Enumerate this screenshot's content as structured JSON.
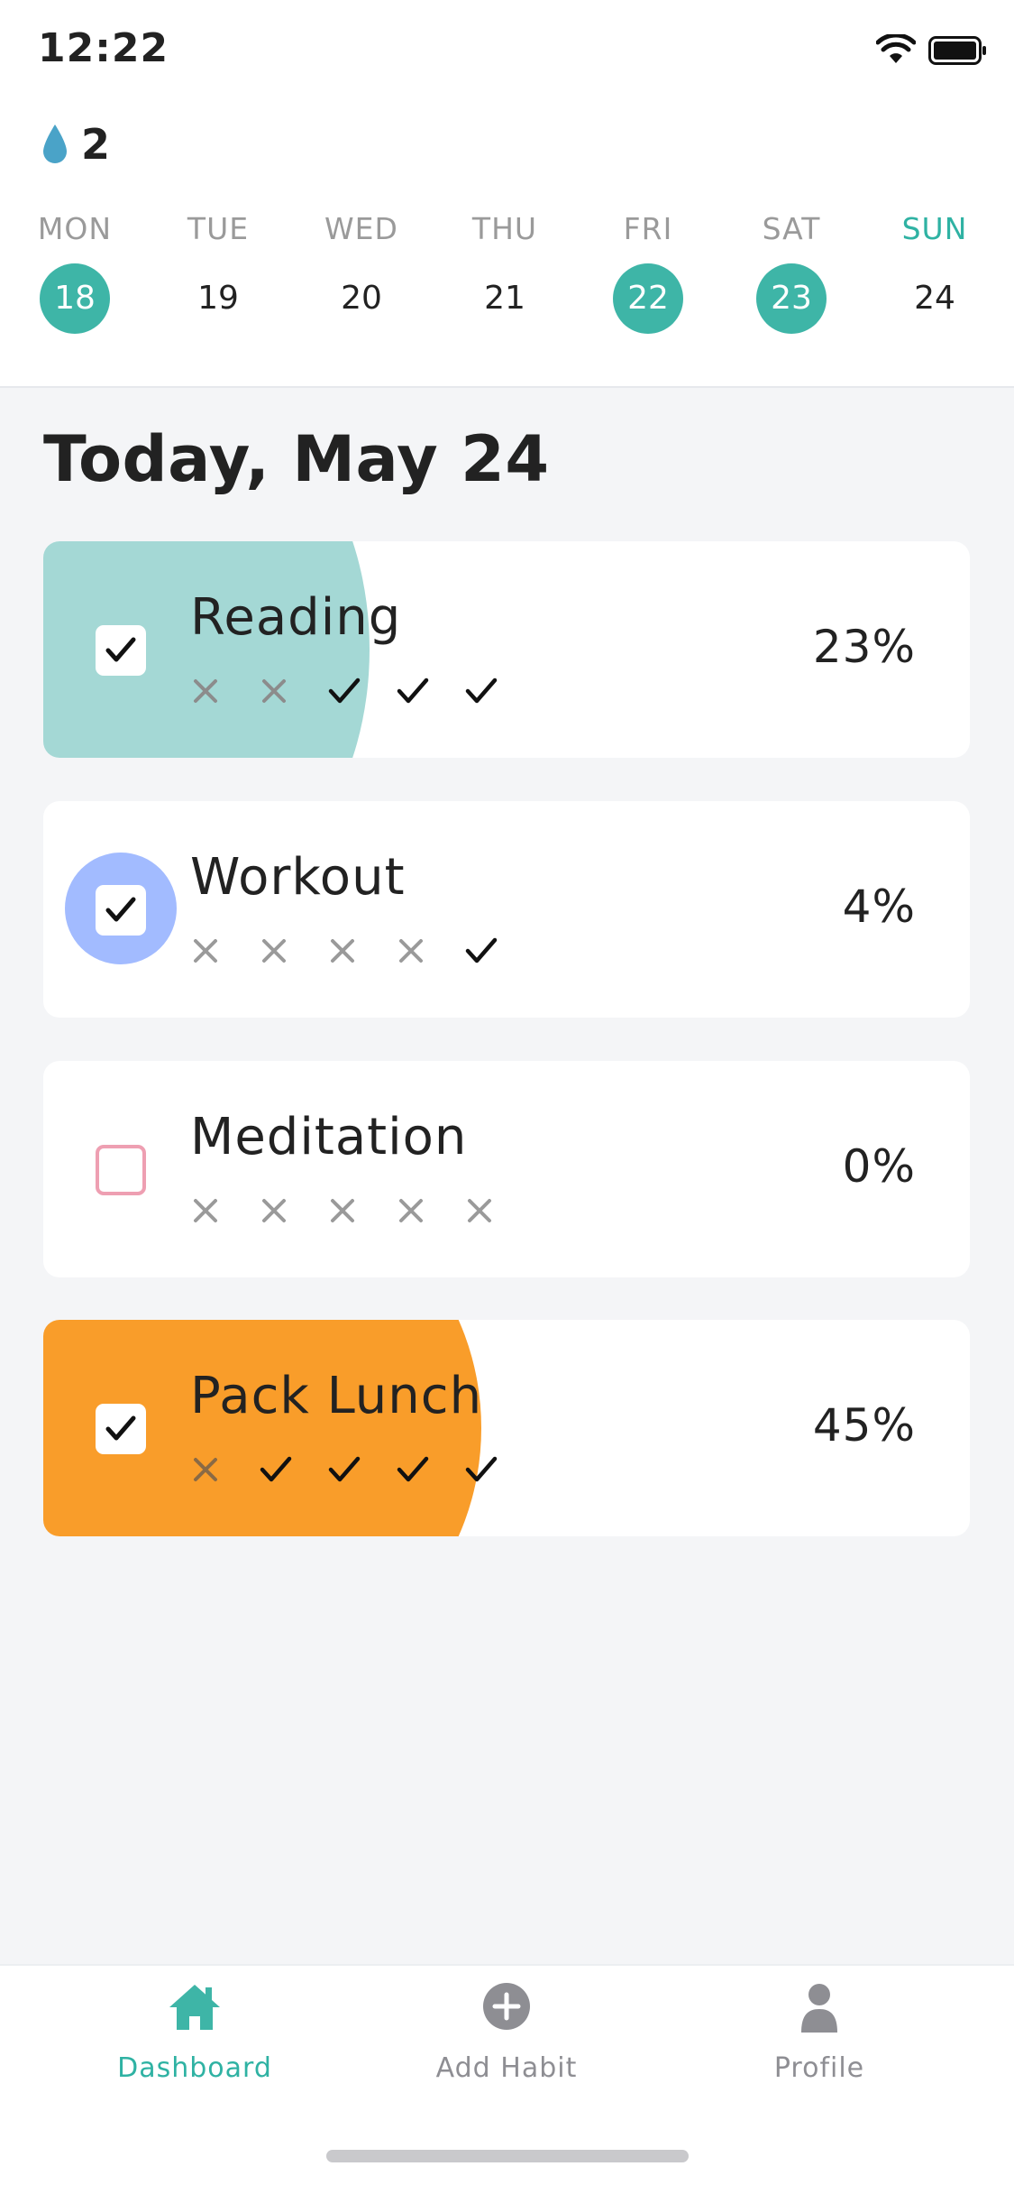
{
  "status_bar": {
    "time": "12:22"
  },
  "streak": {
    "count": "2"
  },
  "week": [
    {
      "day": "MON",
      "date": "18",
      "done": true,
      "today": false
    },
    {
      "day": "TUE",
      "date": "19",
      "done": false,
      "today": false
    },
    {
      "day": "WED",
      "date": "20",
      "done": false,
      "today": false
    },
    {
      "day": "THU",
      "date": "21",
      "done": false,
      "today": false
    },
    {
      "day": "FRI",
      "date": "22",
      "done": true,
      "today": false
    },
    {
      "day": "SAT",
      "date": "23",
      "done": true,
      "today": false
    },
    {
      "day": "SUN",
      "date": "24",
      "done": false,
      "today": true
    }
  ],
  "main": {
    "title": "Today, May 24"
  },
  "habits": [
    {
      "name": "Reading",
      "percent": "23%",
      "progress": 0.23,
      "color": "#a4d8d5",
      "style": "fill",
      "checked": true,
      "history": [
        "x",
        "x",
        "check",
        "check",
        "check"
      ]
    },
    {
      "name": "Workout",
      "percent": "4%",
      "progress": 0.04,
      "color": "#a2bbff",
      "style": "bubble",
      "checked": true,
      "history": [
        "x",
        "x",
        "x",
        "x",
        "check"
      ]
    },
    {
      "name": "Meditation",
      "percent": "0%",
      "progress": 0.0,
      "color": "#ee9fb2",
      "style": "none",
      "checked": false,
      "history": [
        "x",
        "x",
        "x",
        "x",
        "x"
      ]
    },
    {
      "name": "Pack Lunch",
      "percent": "45%",
      "progress": 0.45,
      "color": "#f99d2a",
      "style": "fill",
      "checked": true,
      "history": [
        "x",
        "check",
        "check",
        "check",
        "check"
      ]
    }
  ],
  "nav": {
    "dashboard": "Dashboard",
    "add_habit": "Add Habit",
    "profile": "Profile"
  },
  "colors": {
    "accent": "#3eb5a7",
    "inactive": "#8e8e93"
  }
}
